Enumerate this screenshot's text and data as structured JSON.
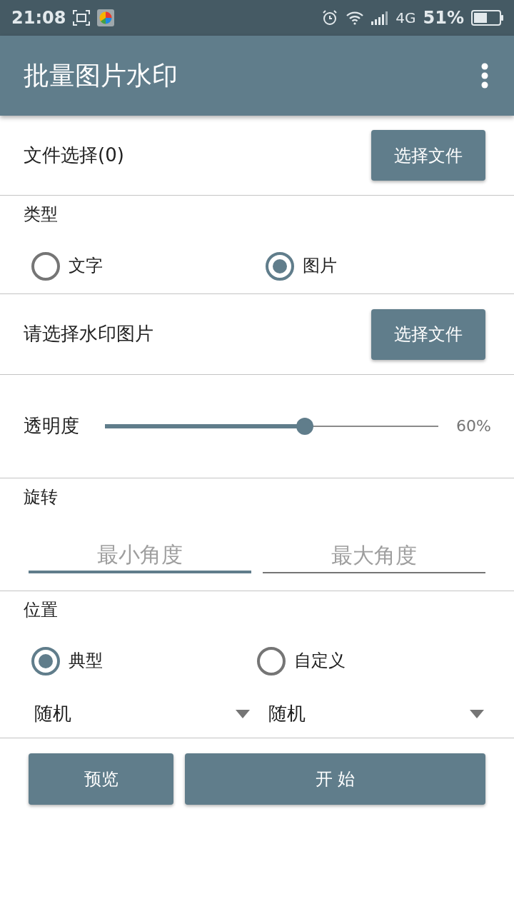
{
  "status_bar": {
    "time": "21:08",
    "network": "4G",
    "battery": "51%"
  },
  "app_bar": {
    "title": "批量图片水印"
  },
  "file_row": {
    "label": "文件选择(0)",
    "button": "选择文件"
  },
  "type_section": {
    "title": "类型",
    "options": [
      {
        "label": "文字",
        "selected": false
      },
      {
        "label": "图片",
        "selected": true
      }
    ]
  },
  "watermark_row": {
    "label": "请选择水印图片",
    "button": "选择文件"
  },
  "opacity": {
    "label": "透明度",
    "level": 0.6,
    "reading": "60%"
  },
  "rotation": {
    "title": "旋转",
    "fields": [
      {
        "placeholder": "最小角度",
        "focused": true
      },
      {
        "placeholder": "最大角度",
        "focused": false
      }
    ]
  },
  "position": {
    "title": "位置",
    "options": [
      {
        "label": "典型",
        "selected": true
      },
      {
        "label": "自定义",
        "selected": false
      }
    ],
    "dropdowns": [
      {
        "value": "随机"
      },
      {
        "value": "随机"
      }
    ]
  },
  "actions": [
    {
      "label": "预览"
    },
    {
      "label": "开 始"
    }
  ]
}
